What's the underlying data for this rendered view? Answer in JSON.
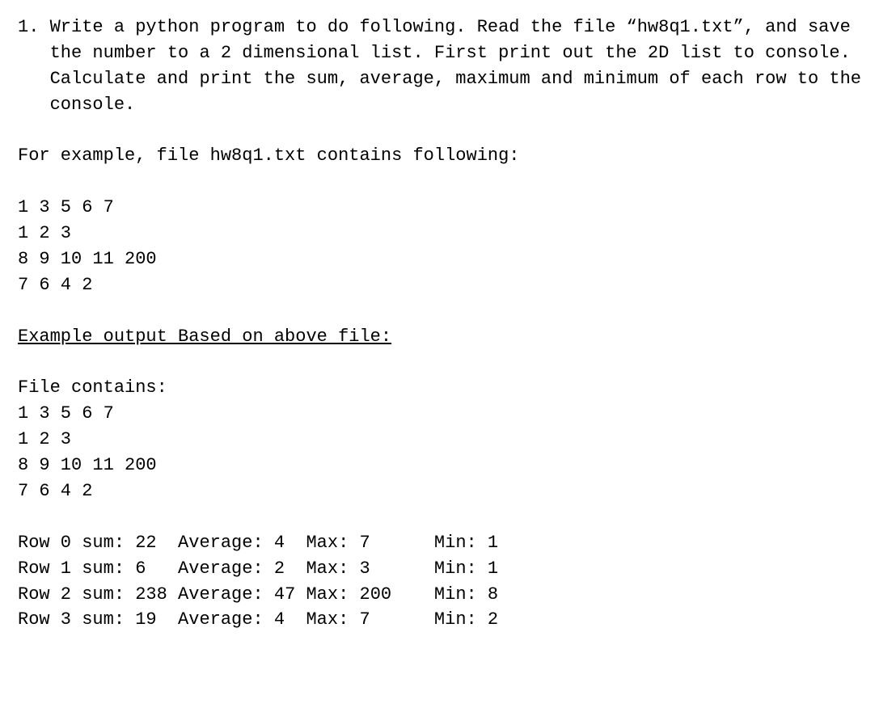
{
  "question": {
    "number": "1. ",
    "text": "Write a python program to do following. Read the file “hw8q1.txt”, and save the number to a 2 dimensional list. First print out the 2D list to console. Calculate and print the sum, average, maximum and minimum of each row to the console."
  },
  "example_intro": "For example, file hw8q1.txt contains following:",
  "file_input": [
    "1 3 5 6 7",
    "1 2 3",
    "8 9 10 11 200",
    "7 6 4 2"
  ],
  "output_heading": "Example output Based on above file:",
  "file_contains_label": "File contains:",
  "file_output": [
    "1 3 5 6 7",
    "1 2 3",
    "8 9 10 11 200",
    "7 6 4 2"
  ],
  "stats": [
    {
      "c0": "Row 0 sum: 22  ",
      "c1": "Average: 4  ",
      "c2": "Max: 7      ",
      "c3": "Min: 1"
    },
    {
      "c0": "Row 1 sum: 6   ",
      "c1": "Average: 2  ",
      "c2": "Max: 3      ",
      "c3": "Min: 1"
    },
    {
      "c0": "Row 2 sum: 238 ",
      "c1": "Average: 47 ",
      "c2": "Max: 200    ",
      "c3": "Min: 8"
    },
    {
      "c0": "Row 3 sum: 19  ",
      "c1": "Average: 4  ",
      "c2": "Max: 7      ",
      "c3": "Min: 2"
    }
  ]
}
